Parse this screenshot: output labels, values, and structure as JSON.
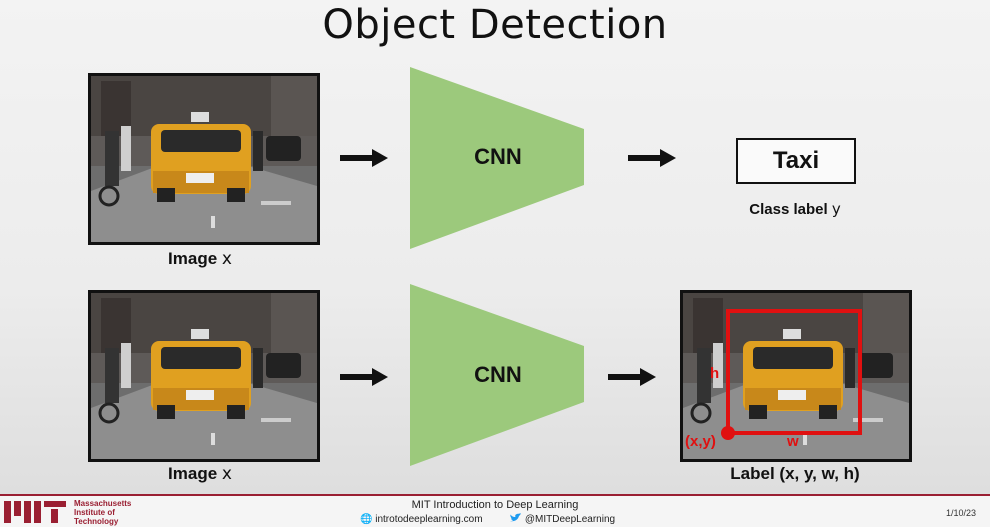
{
  "title": "Object Detection",
  "row1": {
    "image_caption": "Image",
    "image_var": "x",
    "cnn_label": "CNN",
    "class_label": "Taxi",
    "class_caption": "Class label",
    "class_var": "y"
  },
  "row2": {
    "image_caption": "Image",
    "image_var": "x",
    "cnn_label": "CNN",
    "output_caption": "Label (x, y, w, h)",
    "point_label": "(x,y)",
    "w_label": "w",
    "h_label": "h"
  },
  "footer": {
    "institution_lines": [
      "Massachusetts",
      "Institute of",
      "Technology"
    ],
    "course": "MIT Introduction to Deep Learning",
    "website": "introtodeeplearning.com",
    "twitter": "@MITDeepLearning",
    "date": "1/10/23"
  },
  "colors": {
    "cnn_fill": "#9cc97c",
    "bbox": "#e01010",
    "mit_red": "#9a1f32"
  }
}
